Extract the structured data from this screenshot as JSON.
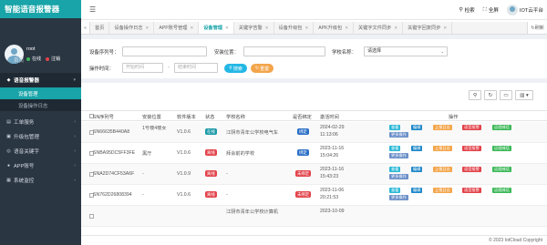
{
  "app": {
    "title": "智能语音报警器"
  },
  "user": {
    "name": "root",
    "status": "在线",
    "logout": "注销"
  },
  "sidebar": {
    "items": [
      {
        "label": "首页"
      },
      {
        "label": "语音报警器"
      },
      {
        "label": "工单服务"
      },
      {
        "label": "升级包管理"
      },
      {
        "label": "语音关键字"
      },
      {
        "label": "APP账号"
      },
      {
        "label": "系统监控"
      }
    ],
    "sub": [
      {
        "label": "设备管理"
      },
      {
        "label": "设备操作日志"
      }
    ]
  },
  "topbar": {
    "search": "检索",
    "fullscreen": "全屏",
    "platform": "IOT云平台"
  },
  "tabs": [
    {
      "label": "首页"
    },
    {
      "label": "设备操作日志"
    },
    {
      "label": "APP账号管理"
    },
    {
      "label": "设备管理"
    },
    {
      "label": "关键字告警"
    },
    {
      "label": "设备升级包"
    },
    {
      "label": "APK升级包"
    },
    {
      "label": "关键字文件同步"
    },
    {
      "label": "关键字回复同步"
    }
  ],
  "tab_end": "刷新",
  "filters": {
    "serial_label": "设备序列号：",
    "location_label": "安装位置：",
    "school_label": "学校名称：",
    "school_value": "请选择",
    "time_label": "操作时间：",
    "start_placeholder": "开始时间",
    "end_placeholder": "结束时间",
    "search_btn": "搜索",
    "reset_btn": "重置"
  },
  "table": {
    "headers": [
      "SN序列号",
      "安装位置",
      "软件版本",
      "状态",
      "学校名称",
      "是否绑定",
      "激活时间",
      "操作"
    ],
    "rows": [
      {
        "sn": "SN66635B440A8",
        "location": "1号楼4楼女",
        "version": "V1.0.6",
        "status": "在线",
        "school": "江阴市青年公学校电气车",
        "bind": "绑定",
        "date": "2024-02-29",
        "time": "11:13:06"
      },
      {
        "sn": "SNBA95DC5FF3FE",
        "location": "黑厅",
        "version": "V1.0.6",
        "status": "离线",
        "school": "拜会前的学校",
        "bind": "绑定",
        "date": "2023-11-16",
        "time": "15:04:26"
      },
      {
        "sn": "SNA2D74CF53A6F",
        "location": "-",
        "version": "V1.0.9",
        "status": "离线",
        "school": "-",
        "bind": "未绑定",
        "date": "2023-11-16",
        "time": "15:43:23"
      },
      {
        "sn": "SN762D26808394",
        "location": "-",
        "version": "V1.0.6",
        "status": "离线",
        "school": "-",
        "bind": "未绑定",
        "date": "2023-11-06",
        "time": "20:21:53"
      },
      {
        "sn": "",
        "location": "",
        "version": "",
        "status": "",
        "school": "江阴市青年公学校计算机",
        "bind": "",
        "date": "2023-10-09",
        "time": ""
      }
    ],
    "actions": {
      "view": "查看",
      "edit": "编辑",
      "log": "上报日志",
      "delete": "语音报警",
      "cam": "远程喊话",
      "more": "更多操作"
    }
  },
  "footer": "© 2023 IotCloud Copyright",
  "colors": {
    "brand": "#18a4a8",
    "sidebar": "#2b3643",
    "online": "#1d9aa8",
    "offline": "#e2434a"
  }
}
